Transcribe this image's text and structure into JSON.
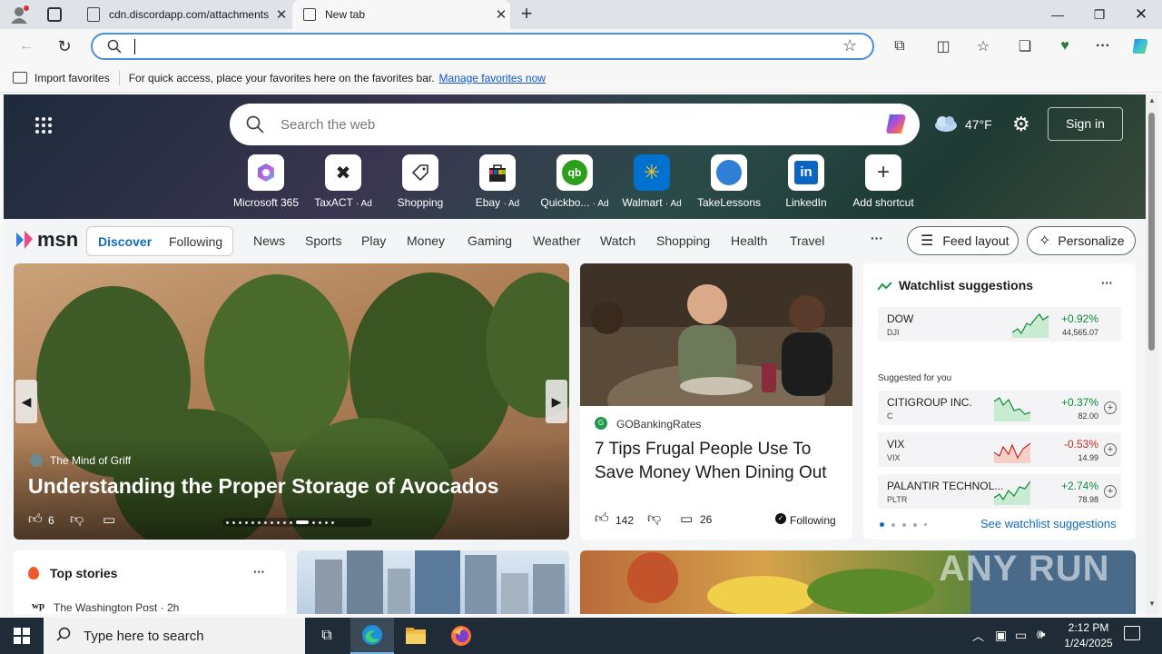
{
  "tabs": [
    {
      "title": "cdn.discordapp.com/attachments"
    },
    {
      "title": "New tab"
    }
  ],
  "favorites_bar": {
    "import_label": "Import favorites",
    "message": "For quick access, place your favorites here on the favorites bar.",
    "manage_link": "Manage favorites now"
  },
  "hero": {
    "search_placeholder": "Search the web",
    "weather_temp": "47°F",
    "sign_in": "Sign in",
    "shortcuts": [
      {
        "label": "Microsoft 365",
        "ad": ""
      },
      {
        "label": "TaxACT",
        "ad": "· Ad"
      },
      {
        "label": "Shopping",
        "ad": ""
      },
      {
        "label": "Ebay",
        "ad": "· Ad"
      },
      {
        "label": "Quickbo...",
        "ad": "· Ad"
      },
      {
        "label": "Walmart",
        "ad": "· Ad"
      },
      {
        "label": "TakeLessons",
        "ad": ""
      },
      {
        "label": "LinkedIn",
        "ad": ""
      },
      {
        "label": "Add shortcut",
        "ad": ""
      }
    ]
  },
  "msn": {
    "logo": "msn",
    "tabs": [
      "Discover",
      "Following"
    ],
    "nav": [
      "News",
      "Sports",
      "Play",
      "Money",
      "Gaming",
      "Weather",
      "Watch",
      "Shopping",
      "Health",
      "Travel"
    ],
    "more": "···",
    "feed_layout": "Feed layout",
    "personalize": "Personalize"
  },
  "featured": {
    "source": "The Mind of Griff",
    "title": "Understanding the Proper Storage of Avocados",
    "likes": "6"
  },
  "article": {
    "source": "GOBankingRates",
    "title": "7 Tips Frugal People Use To Save Money When Dining Out",
    "likes": "142",
    "comments": "26",
    "following": "Following"
  },
  "watchlist": {
    "title": "Watchlist suggestions",
    "more": "···",
    "primary": {
      "name": "DOW",
      "symbol": "DJI",
      "change": "+0.92%",
      "price": "44,565.07"
    },
    "suggested_label": "Suggested for you",
    "items": [
      {
        "name": "CITIGROUP INC.",
        "symbol": "C",
        "change": "+0.37%",
        "price": "82.00"
      },
      {
        "name": "VIX",
        "symbol": "VIX",
        "change": "-0.53%",
        "price": "14.99"
      },
      {
        "name": "PALANTIR TECHNOL...",
        "symbol": "PLTR",
        "change": "+2.74%",
        "price": "78.98"
      }
    ],
    "see_link": "See watchlist suggestions"
  },
  "top_stories": {
    "title": "Top stories",
    "more": "···",
    "source": "The Washington Post · 2h",
    "source_logo": "wp"
  },
  "watermark": "ANY RUN",
  "taskbar": {
    "search_placeholder": "Type here to search",
    "time": "2:12 PM",
    "date": "1/24/2025"
  },
  "colors": {
    "accent": "#0f6cbd",
    "positive": "#0a8a3b",
    "negative": "#c42b1c"
  }
}
